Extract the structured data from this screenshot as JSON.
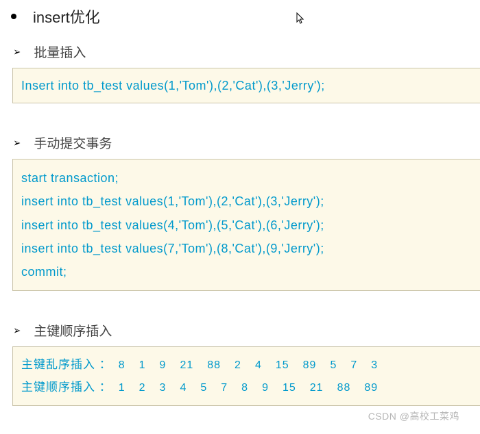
{
  "title": "insert优化",
  "sections": [
    {
      "header": "批量插入",
      "code": [
        "Insert into tb_test values(1,'Tom'),(2,'Cat'),(3,'Jerry');"
      ]
    },
    {
      "header": "手动提交事务",
      "code": [
        "start transaction;",
        "insert into tb_test values(1,'Tom'),(2,'Cat'),(3,'Jerry');",
        "insert into tb_test values(4,'Tom'),(5,'Cat'),(6,'Jerry');",
        "insert into tb_test values(7,'Tom'),(8,'Cat'),(9,'Jerry');",
        "commit;"
      ]
    }
  ],
  "pk_section": {
    "header": "主键顺序插入",
    "rows": [
      {
        "label": "主键乱序插入 ：",
        "values": [
          "8",
          "1",
          "9",
          "21",
          "88",
          "2",
          "4",
          "15",
          "89",
          "5",
          "7",
          "3"
        ]
      },
      {
        "label": "主键顺序插入 ：",
        "values": [
          "1",
          "2",
          "3",
          "4",
          "5",
          "7",
          "8",
          "9",
          "15",
          "21",
          "88",
          "89"
        ]
      }
    ]
  },
  "watermark": "CSDN @高校工菜鸡"
}
